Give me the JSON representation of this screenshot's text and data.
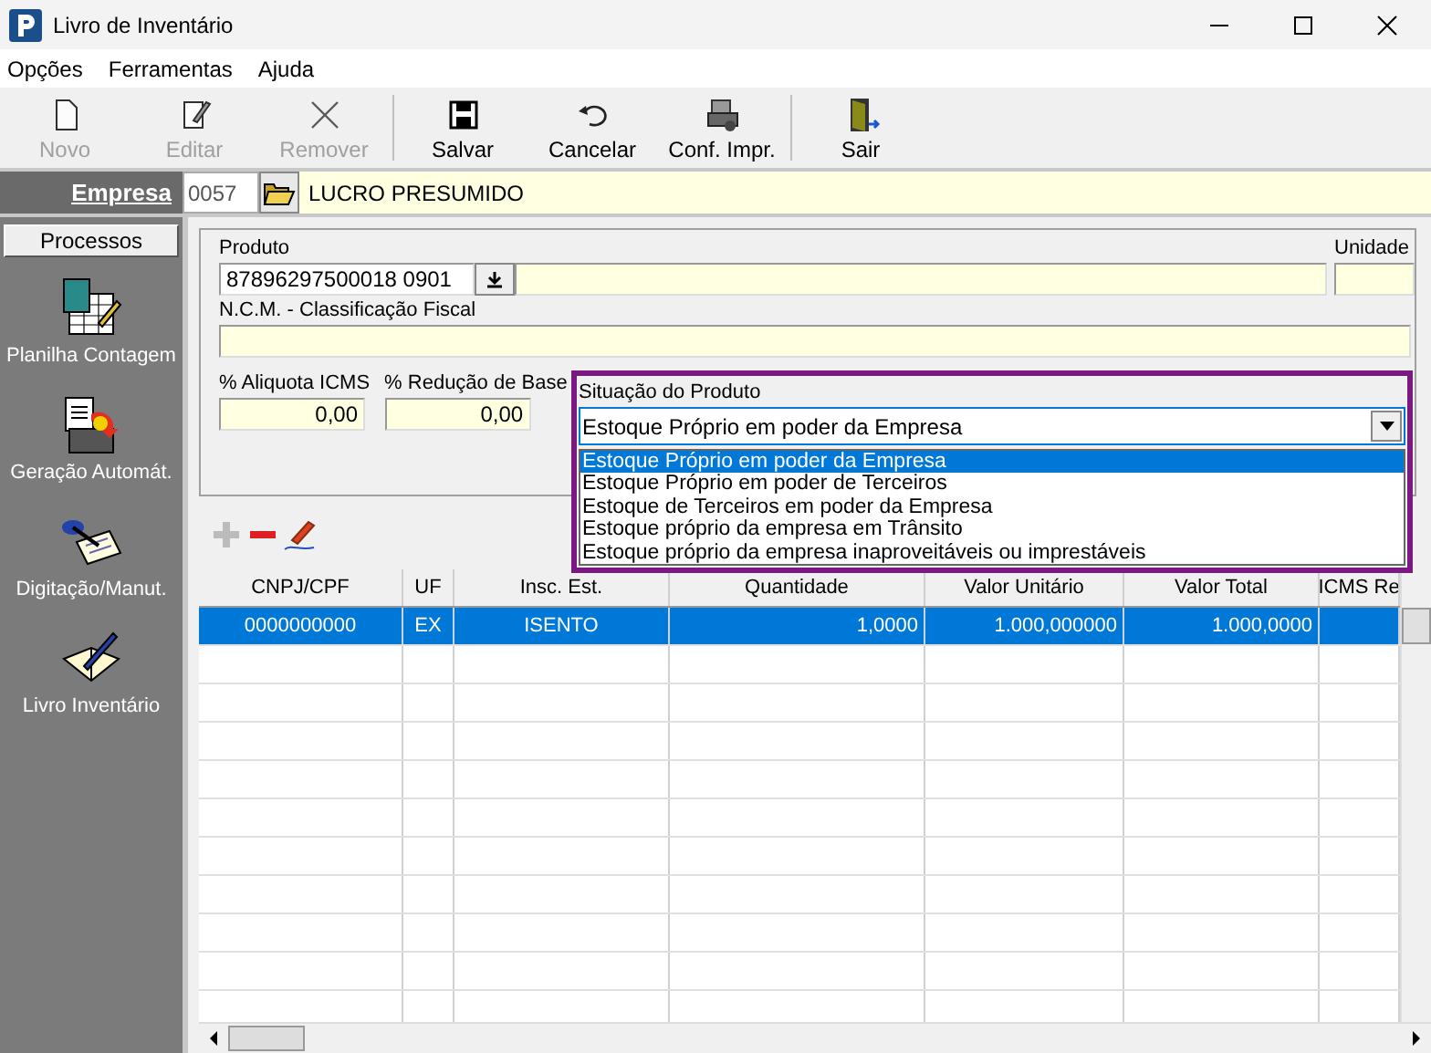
{
  "window": {
    "title": "Livro de Inventário"
  },
  "menu": [
    "Opções",
    "Ferramentas",
    "Ajuda"
  ],
  "toolbar": [
    [
      {
        "label": "Novo",
        "kind": "new",
        "disabled": true
      },
      {
        "label": "Editar",
        "kind": "edit",
        "disabled": true
      },
      {
        "label": "Remover",
        "kind": "remove",
        "disabled": true
      }
    ],
    [
      {
        "label": "Salvar",
        "kind": "save",
        "disabled": false
      },
      {
        "label": "Cancelar",
        "kind": "undo",
        "disabled": false
      },
      {
        "label": "Conf. Impr.",
        "kind": "printer",
        "disabled": false
      }
    ],
    [
      {
        "label": "Sair",
        "kind": "exit",
        "disabled": false
      }
    ]
  ],
  "company": {
    "label": "Empresa",
    "code": "0057",
    "name": "LUCRO PRESUMIDO"
  },
  "sidebar": {
    "title": "Processos",
    "items": [
      {
        "label": "Planilha Contagem",
        "kind": "spreadsheet"
      },
      {
        "label": "Geração Automát.",
        "kind": "generate"
      },
      {
        "label": "Digitação/Manut.",
        "kind": "typing"
      },
      {
        "label": "Livro Inventário",
        "kind": "book"
      }
    ]
  },
  "form": {
    "product": {
      "label": "Produto",
      "value": "87896297500018 0901"
    },
    "unit": {
      "label": "Unidade"
    },
    "ncm": {
      "label": "N.C.M. - Classificação Fiscal"
    },
    "icms": {
      "label": "% Aliquota ICMS",
      "value": "0,00"
    },
    "reduction": {
      "label": "% Redução de Base",
      "value": "0,00"
    },
    "situation": {
      "label": "Situação do Produto",
      "value": "Estoque Próprio em poder da Empresa",
      "expanded": true,
      "options": [
        {
          "label": "Estoque Próprio em poder da Empresa",
          "selected": true
        },
        {
          "label": "Estoque Próprio em poder de Terceiros",
          "selected": false
        },
        {
          "label": "Estoque de Terceiros em poder da Empresa",
          "selected": false
        },
        {
          "label": "Estoque próprio da empresa em Trânsito",
          "selected": false
        },
        {
          "label": "Estoque próprio da empresa inaproveitáveis ou imprestáveis",
          "selected": false
        }
      ]
    }
  },
  "grid_tools": [
    {
      "kind": "add",
      "disabled": true
    },
    {
      "kind": "remove",
      "disabled": false
    },
    {
      "kind": "edit",
      "disabled": false
    }
  ],
  "grid": {
    "columns": [
      "CNPJ/CPF",
      "UF",
      "Insc. Est.",
      "Quantidade",
      "Valor Unitário",
      "Valor Total",
      "ICMS Re"
    ],
    "rows": [
      {
        "selected": true,
        "cells": [
          "0000000000",
          "EX",
          "ISENTO",
          "1,0000",
          "1.000,000000",
          "1.000,0000",
          ""
        ]
      }
    ]
  }
}
